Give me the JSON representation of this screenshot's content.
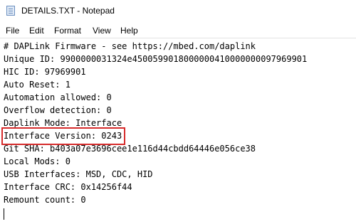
{
  "window": {
    "title": "DETAILS.TXT - Notepad"
  },
  "menu": [
    "File",
    "Edit",
    "Format",
    "View",
    "Help"
  ],
  "lines": [
    "# DAPLink Firmware - see https://mbed.com/daplink",
    "Unique ID: 9900000031324e4500599018000000410000000097969901",
    "HIC ID: 97969901",
    "Auto Reset: 1",
    "Automation allowed: 0",
    "Overflow detection: 0",
    "Daplink Mode: Interface",
    "Interface Version: 0243",
    "Git SHA: b403a07e3696cee1e116d44cbdd64446e056ce38",
    "Local Mods: 0",
    "USB Interfaces: MSD, CDC, HID",
    "Interface CRC: 0x14256f44",
    "Remount count: 0"
  ],
  "highlight": {
    "color": "#d62b2b",
    "target": "Interface Version: 0243"
  },
  "icons": {
    "app": "notepad-icon"
  }
}
